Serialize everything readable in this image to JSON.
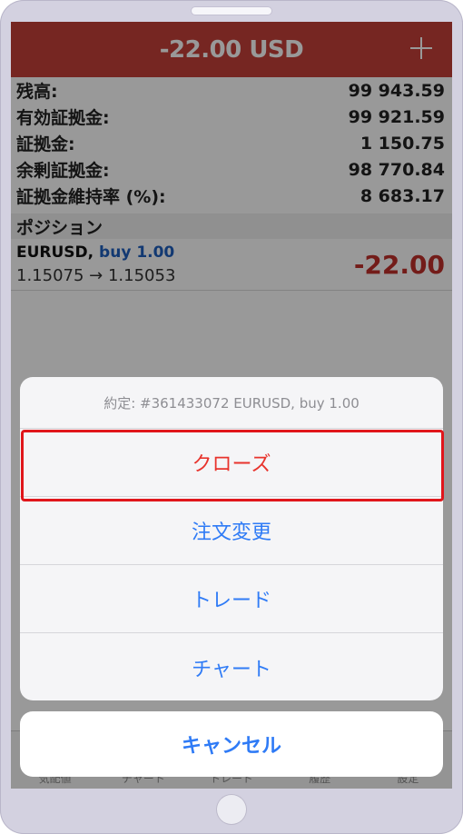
{
  "header": {
    "title": "-22.00 USD"
  },
  "account": [
    {
      "label": "残高:",
      "value": "99 943.59"
    },
    {
      "label": "有効証拠金:",
      "value": "99 921.59"
    },
    {
      "label": "証拠金:",
      "value": "1 150.75"
    },
    {
      "label": "余剰証拠金:",
      "value": "98 770.84"
    },
    {
      "label": "証拠金維持率 (%):",
      "value": "8 683.17"
    }
  ],
  "positions": {
    "section_label": "ポジション",
    "row": {
      "symbol": "EURUSD,",
      "side": "buy 1.00",
      "prices": "1.15075 → 1.15053",
      "profit": "-22.00"
    }
  },
  "tabbar": [
    "気配値",
    "チャート",
    "トレード",
    "履歴",
    "設定"
  ],
  "action_sheet": {
    "title": "約定: #361433072 EURUSD, buy 1.00",
    "actions": [
      "クローズ",
      "注文変更",
      "トレード",
      "チャート"
    ],
    "cancel_label": "キャンセル"
  },
  "colors": {
    "header_bg": "#c5403a",
    "action_blue": "#2f7bf6",
    "destructive_red": "#e8332c",
    "highlight_red": "#e0161b"
  }
}
